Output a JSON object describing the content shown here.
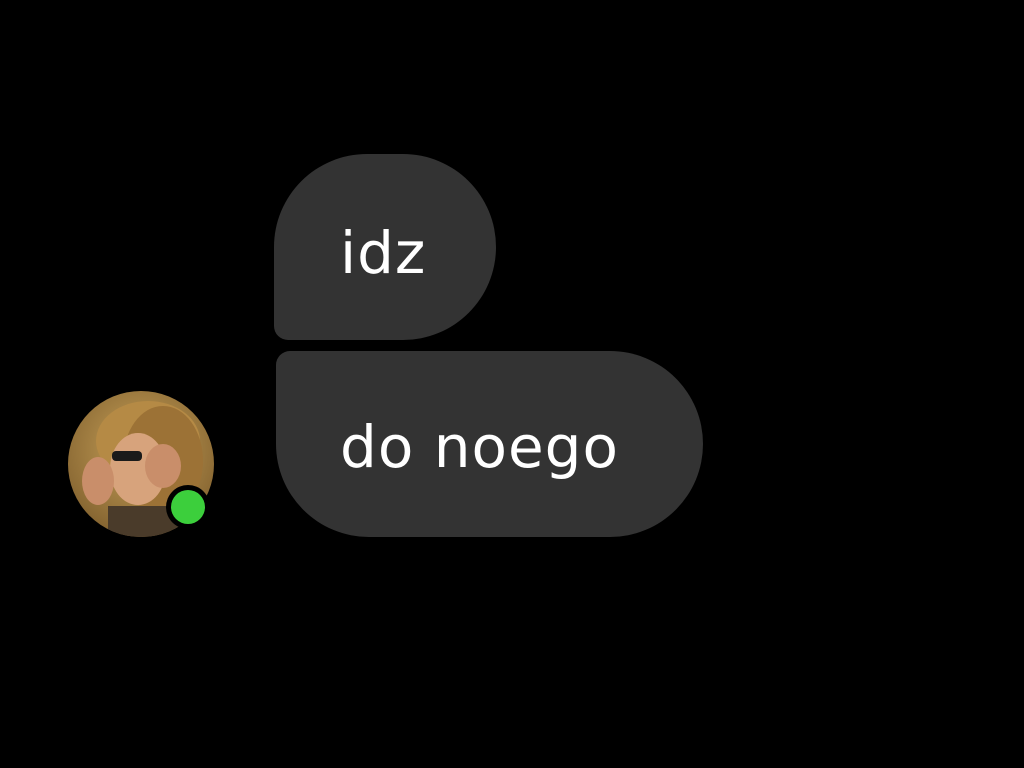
{
  "conversation": {
    "messages": [
      {
        "text": "idz"
      },
      {
        "text": "do noego"
      }
    ],
    "sender": {
      "online": true,
      "presence_color": "#3ccf3c"
    }
  },
  "theme": {
    "background": "#000000",
    "bubble_color": "#333333",
    "text_color": "#ffffff"
  }
}
